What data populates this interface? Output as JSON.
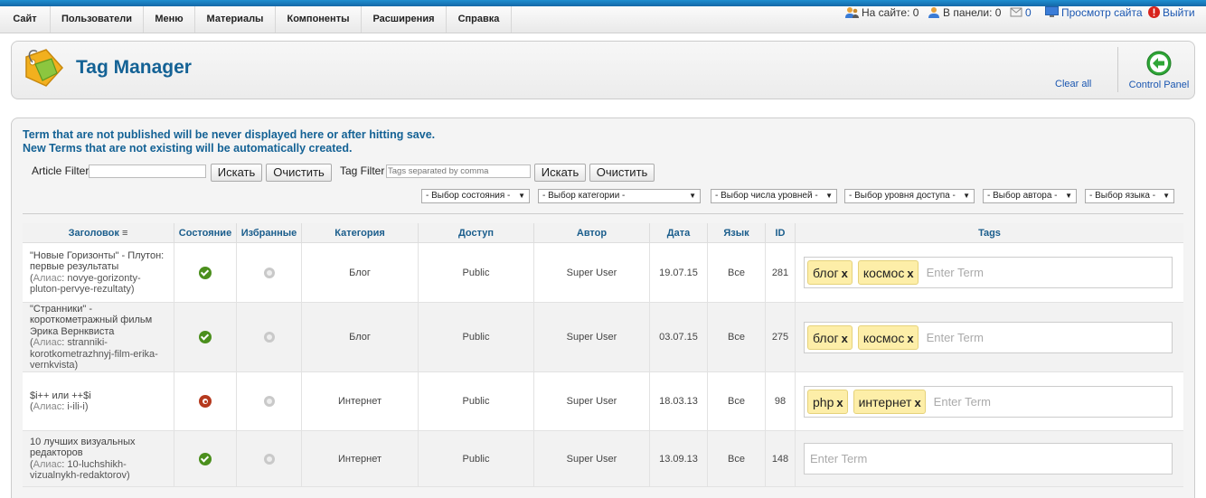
{
  "menu": {
    "items": [
      "Сайт",
      "Пользователи",
      "Меню",
      "Материалы",
      "Компоненты",
      "Расширения",
      "Справка"
    ]
  },
  "status": {
    "online_site": "На сайте: 0",
    "online_admin": "В панели: 0",
    "messages": "0",
    "view_site": "Просмотр сайта",
    "logout": "Выйти"
  },
  "header": {
    "title": "Tag Manager",
    "clear_all": "Clear all",
    "control_panel": "Control Panel"
  },
  "info": {
    "line1": "Term that are not published will be never displayed here or after hitting save.",
    "line2": "New Terms that are not existing will be automatically created."
  },
  "filters": {
    "article_label": "Article Filter",
    "article_value": "",
    "search_btn": "Искать",
    "clear_btn": "Очистить",
    "tag_label": "Tag Filter",
    "tag_placeholder": "Tags separated by comma",
    "selects": [
      "- Выбор состояния -",
      "- Выбор категории -",
      "- Выбор числа уровней -",
      "- Выбор уровня доступа -",
      "- Выбор автора -",
      "- Выбор языка -"
    ]
  },
  "table": {
    "headers": {
      "title": "Заголовок",
      "state": "Состояние",
      "featured": "Избранные",
      "category": "Категория",
      "access": "Доступ",
      "author": "Автор",
      "date": "Дата",
      "language": "Язык",
      "id": "ID",
      "tags": "Tags"
    },
    "alias_label": "Алиас",
    "enter_term": "Enter Term",
    "tag_remove": "x",
    "rows": [
      {
        "title": "\"Новые Горизонты\" - Плутон: первые результаты",
        "alias": "novye-gorizonty-pluton-pervye-rezultaty",
        "state": "published",
        "category": "Блог",
        "access": "Public",
        "author": "Super User",
        "date": "19.07.15",
        "language": "Все",
        "id": "281",
        "tags": [
          "блог",
          "космос"
        ]
      },
      {
        "title": "\"Странники\" - короткометражный фильм Эрика Вернквиста",
        "alias": "stranniki-korotkometrazhnyj-film-erika-vernkvista",
        "state": "published",
        "category": "Блог",
        "access": "Public",
        "author": "Super User",
        "date": "03.07.15",
        "language": "Все",
        "id": "275",
        "tags": [
          "блог",
          "космос"
        ]
      },
      {
        "title": "$i++ или ++$i",
        "alias": "i-ili-i",
        "state": "unpublished",
        "category": "Интернет",
        "access": "Public",
        "author": "Super User",
        "date": "18.03.13",
        "language": "Все",
        "id": "98",
        "tags": [
          "php",
          "интернет"
        ]
      },
      {
        "title": "10 лучших визуальных редакторов",
        "alias": "10-luchshikh-vizualnykh-redaktorov",
        "state": "published",
        "category": "Интернет",
        "access": "Public",
        "author": "Super User",
        "date": "13.09.13",
        "language": "Все",
        "id": "148",
        "tags": []
      }
    ]
  },
  "colors": {
    "title_blue": "#146295",
    "link_blue": "#1b57b1",
    "published_green": "#4b8f1d",
    "unpublished_red": "#b5391e",
    "tag_bg": "#fdeea8"
  }
}
